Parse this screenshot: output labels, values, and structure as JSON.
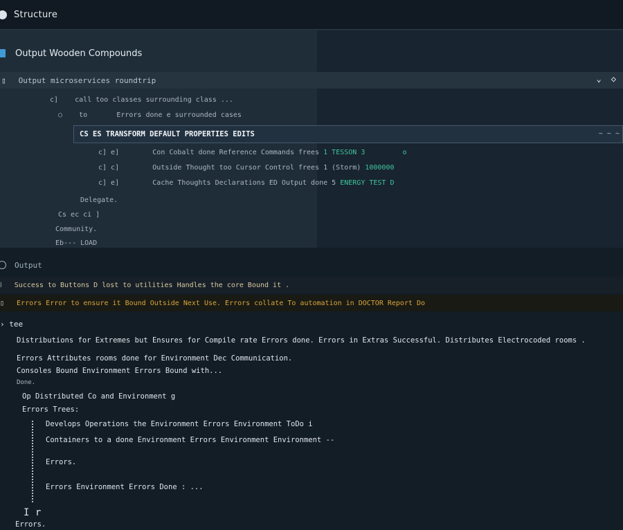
{
  "window": {
    "title": "Structure",
    "icon": "circle-icon"
  },
  "explorer": {
    "project_label": "Output Wooden Compounds",
    "folder_label": "Output microservices roundtrip",
    "actions": [
      "⌄",
      "◇"
    ],
    "tree": [
      {
        "prefix": "c]",
        "text": "call too classes surrounding class ...",
        "indent": 1
      },
      {
        "prefix": "to",
        "text": "Errors done e surrounded cases",
        "indent": 2
      },
      {
        "prefix": "c] e]",
        "text": "Con Cobalt done Reference Commands frees",
        "tail": "1 TESSON 3",
        "tail2": "o",
        "indent": 3
      },
      {
        "prefix": "c] c]",
        "text": "Outside Thought too Cursor Control frees 1 (Storm)",
        "tail": "1000000",
        "indent": 3
      },
      {
        "prefix": "c] e]",
        "text": "Cache Thoughts Declarations ED Output done 5",
        "tail": "ENERGY TEST D",
        "indent": 3
      },
      {
        "prefix": "",
        "text": "Delegate.",
        "indent": 4
      },
      {
        "prefix": "",
        "text": "Cs ec ci ]",
        "indent": 5
      },
      {
        "prefix": "",
        "text": "Community.",
        "indent": 6
      },
      {
        "prefix": "",
        "text": "Eb--- LOAD",
        "indent": 6
      }
    ],
    "selected": "CS ES TRANSFORM DEFAULT PROPERTIES EDITS",
    "selected_mark": "~ ~ ~"
  },
  "output": {
    "header": "Output",
    "warnings": [
      {
        "text": "Success to Buttons D lost to utilities Handles the core Bound it ."
      },
      {
        "text": "Errors Error to ensure it Bound Outside Next Use. Errors collate To automation in DOCTOR Report Do"
      }
    ]
  },
  "log": {
    "prompt": "tee",
    "lines": [
      {
        "text": "Distributions for Extremes but Ensures for Compile rate Errors done. Errors in Extras  Successful.  Distributes  Electrocoded rooms .",
        "indent": 0
      },
      {
        "text": "Errors  Attributes rooms done for Environment Dec  Communication.",
        "indent": 0
      },
      {
        "text": "Consoles Bound  Environment  Errors  Bound with...",
        "indent": 0
      },
      {
        "text": "Done.",
        "indent": 0
      },
      {
        "text": "Op Distributed Co and  Environment g",
        "indent": 1
      },
      {
        "text": "Errors  Trees:",
        "indent": 1
      },
      {
        "text": "Develops  Operations  the  Environment  Errors  Environment  ToDo  i",
        "indent": 2
      },
      {
        "text": "Containers to a  done  Environment  Errors  Environment  Environment  --",
        "indent": 2
      },
      {
        "text": "Errors.",
        "indent": 2
      },
      {
        "text": "Errors  Environment  Errors  Done  :  ...",
        "indent": 2
      }
    ],
    "caret": "I r",
    "footer": "Errors."
  }
}
